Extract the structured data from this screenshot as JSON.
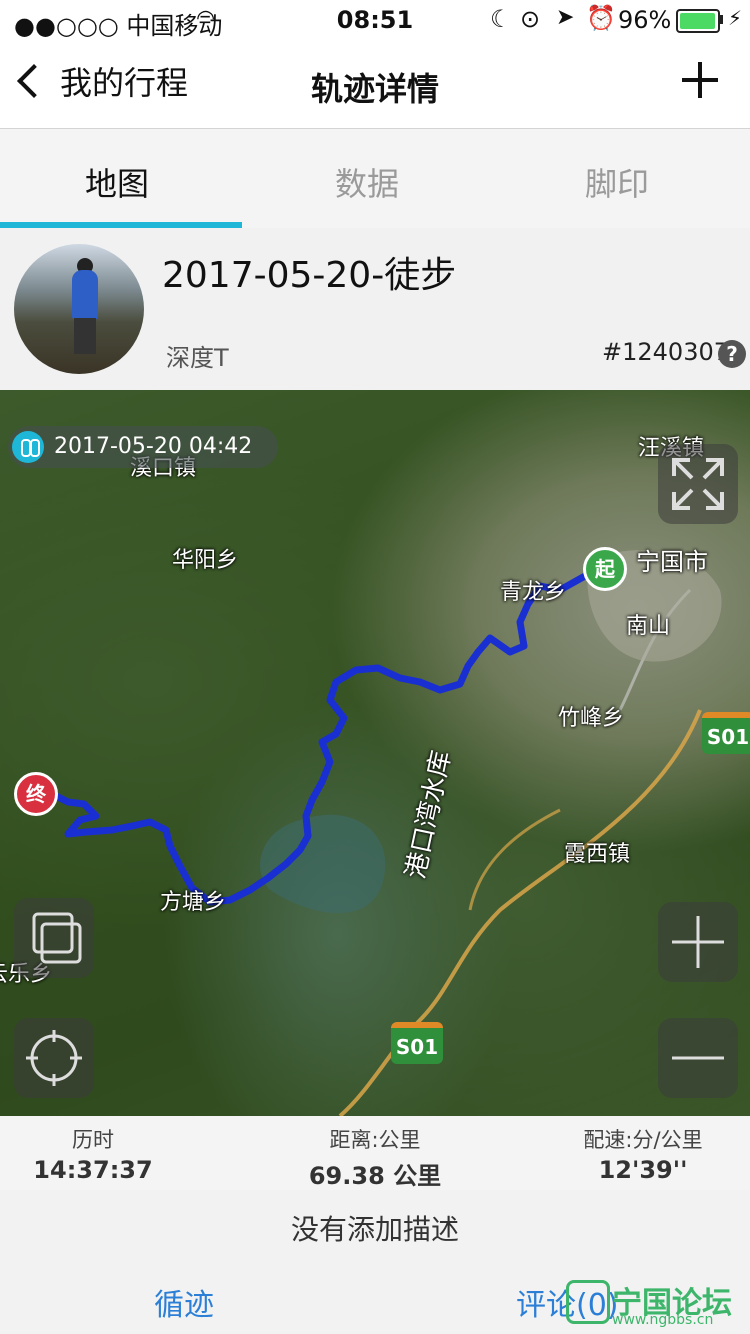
{
  "status_bar": {
    "carrier": "●●○○○ 中国移动",
    "time": "08:51",
    "battery_percent_text": "96%",
    "battery_level": 0.96,
    "icons": [
      "signal-icon",
      "wifi-icon",
      "moon-icon",
      "rotation-lock-icon",
      "location-arrow-icon",
      "alarm-icon",
      "battery-icon",
      "charging-icon"
    ]
  },
  "nav": {
    "back_label": "我的行程",
    "title": "轨迹详情"
  },
  "tabs": [
    {
      "label": "地图",
      "active": true
    },
    {
      "label": "数据",
      "active": false
    },
    {
      "label": "脚印",
      "active": false
    }
  ],
  "track": {
    "title": "2017-05-20-徒步",
    "user": "深度T",
    "id": "#1240307",
    "help": "?"
  },
  "map": {
    "date_label": "2017-05-20 04:42",
    "start_marker": "起",
    "end_marker": "终",
    "place_labels": {
      "xikou": "溪口镇",
      "huayang": "华阳乡",
      "wangxi": "汪溪镇",
      "ningguo": "宁国市",
      "qinglong": "青龙乡",
      "nanshan": "南山",
      "zhufeng": "竹峰乡",
      "xiaxi": "霞西镇",
      "fangtang": "方塘乡",
      "yunle": "云乐乡",
      "reservoir": "港口湾水库"
    },
    "road_badges": [
      "S01",
      "S01"
    ],
    "track_color": "#1a2fd1",
    "start_color": "#3aa84a",
    "end_color": "#d9303f"
  },
  "stats": [
    {
      "label": "历时",
      "value": "14:37:37"
    },
    {
      "label": "距离:公里",
      "value": "69.38 公里"
    },
    {
      "label": "配速:分/公里",
      "value": "12'39''"
    }
  ],
  "description": "没有添加描述",
  "bottom": {
    "follow_label": "循迹",
    "comment_label": "评论(0)"
  },
  "watermark": {
    "text": "宁国论坛",
    "url": "www.ngbbs.cn"
  }
}
